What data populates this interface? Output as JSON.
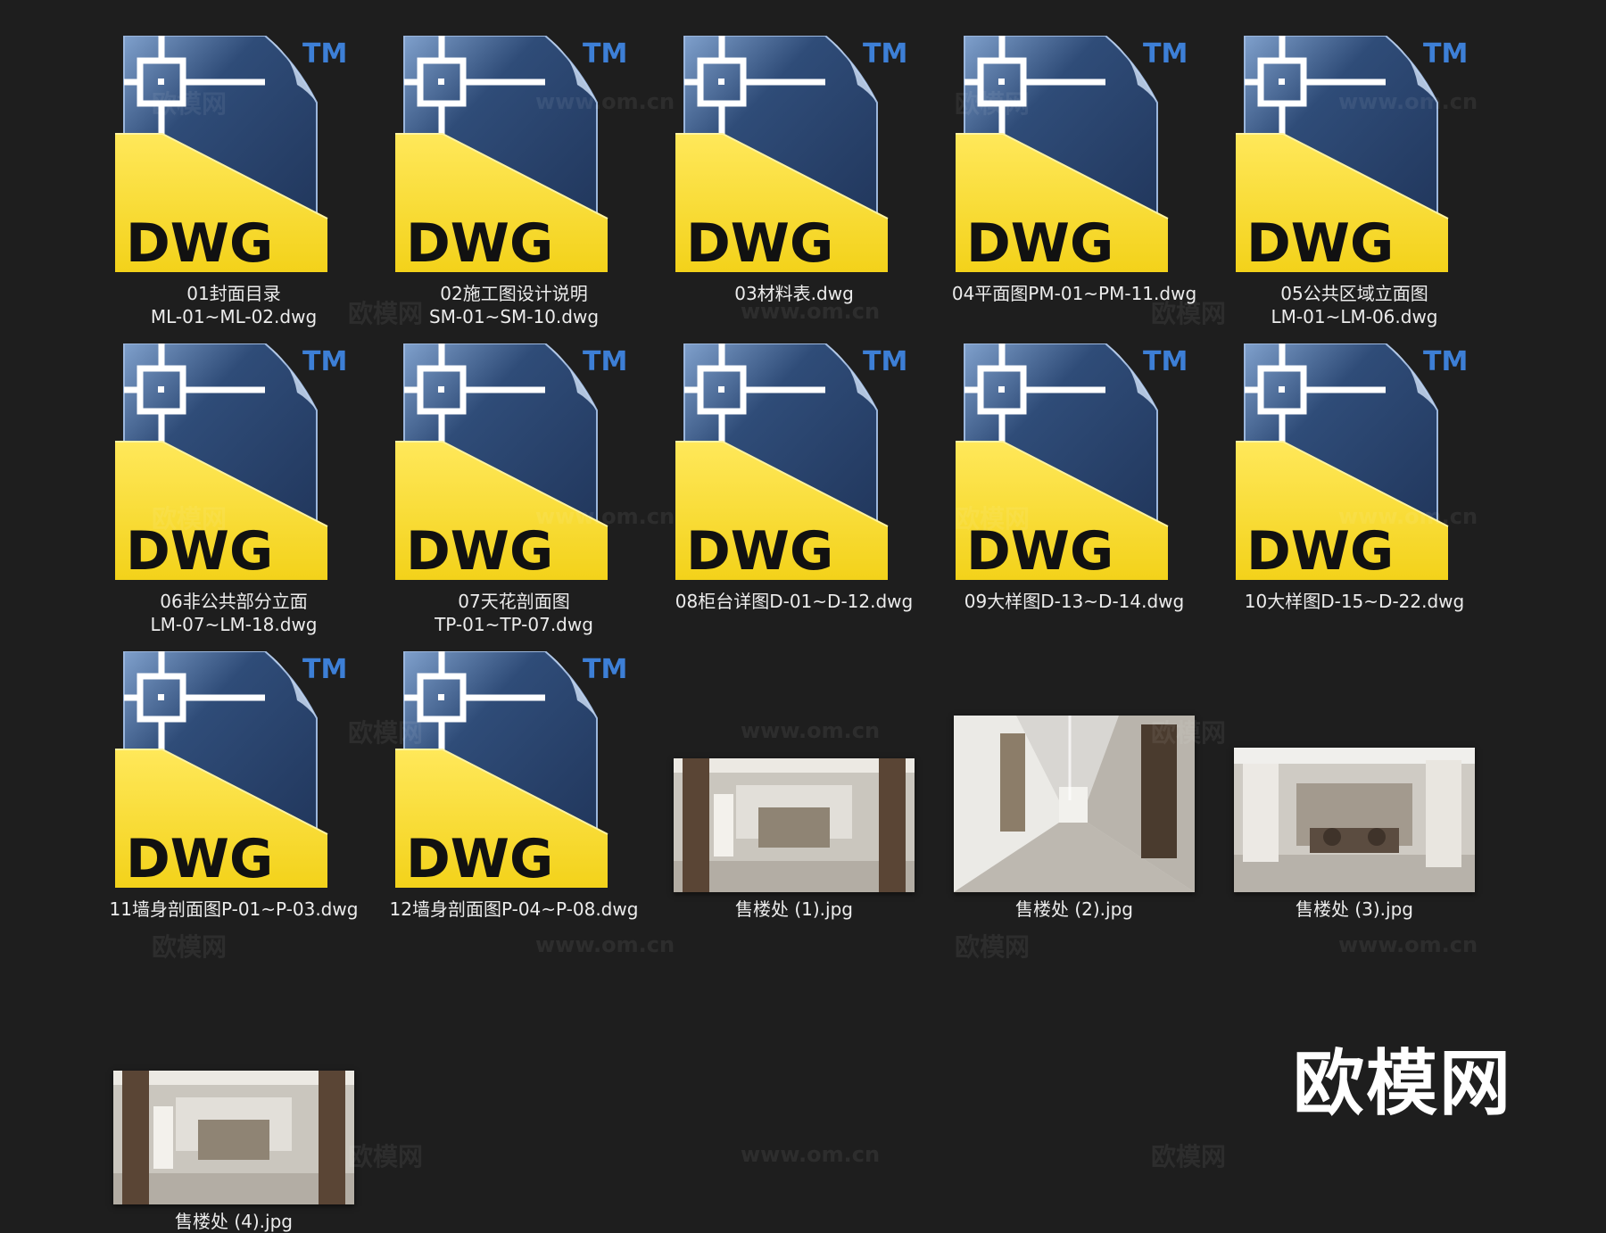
{
  "colors": {
    "background": "#1e1e1e",
    "label_text": "#ececec",
    "dwg_blue": "#2f4c78",
    "dwg_yellow": "#f3d21a",
    "tm_blue": "#3d7fd6"
  },
  "icon": {
    "type_text": "DWG",
    "tm_text": "TM"
  },
  "files": [
    {
      "type": "dwg",
      "line1": "01封面目录",
      "line2": "ML-01~ML-02.dwg"
    },
    {
      "type": "dwg",
      "line1": "02施工图设计说明",
      "line2": "SM-01~SM-10.dwg"
    },
    {
      "type": "dwg",
      "line1": "03材料表.dwg",
      "line2": ""
    },
    {
      "type": "dwg",
      "line1": "04平面图PM-01~PM-11.dwg",
      "line2": ""
    },
    {
      "type": "dwg",
      "line1": "05公共区域立面图",
      "line2": "LM-01~LM-06.dwg"
    },
    {
      "type": "dwg",
      "line1": "06非公共部分立面",
      "line2": "LM-07~LM-18.dwg"
    },
    {
      "type": "dwg",
      "line1": "07天花剖面图",
      "line2": "TP-01~TP-07.dwg"
    },
    {
      "type": "dwg",
      "line1": "08柜台详图D-01~D-12.dwg",
      "line2": ""
    },
    {
      "type": "dwg",
      "line1": "09大样图D-13~D-14.dwg",
      "line2": ""
    },
    {
      "type": "dwg",
      "line1": "10大样图D-15~D-22.dwg",
      "line2": ""
    },
    {
      "type": "dwg",
      "line1": "11墙身剖面图P-01~P-03.dwg",
      "line2": ""
    },
    {
      "type": "dwg",
      "line1": "12墙身剖面图P-04~P-08.dwg",
      "line2": ""
    },
    {
      "type": "jpg",
      "line1": "售楼处 (1).jpg",
      "line2": ""
    },
    {
      "type": "jpg",
      "line1": "售楼处 (2).jpg",
      "line2": ""
    },
    {
      "type": "jpg",
      "line1": "售楼处 (3).jpg",
      "line2": ""
    },
    {
      "type": "jpg",
      "line1": "售楼处 (4).jpg",
      "line2": ""
    }
  ],
  "watermark": {
    "brand": "欧模网",
    "url": "www.om.cn"
  }
}
